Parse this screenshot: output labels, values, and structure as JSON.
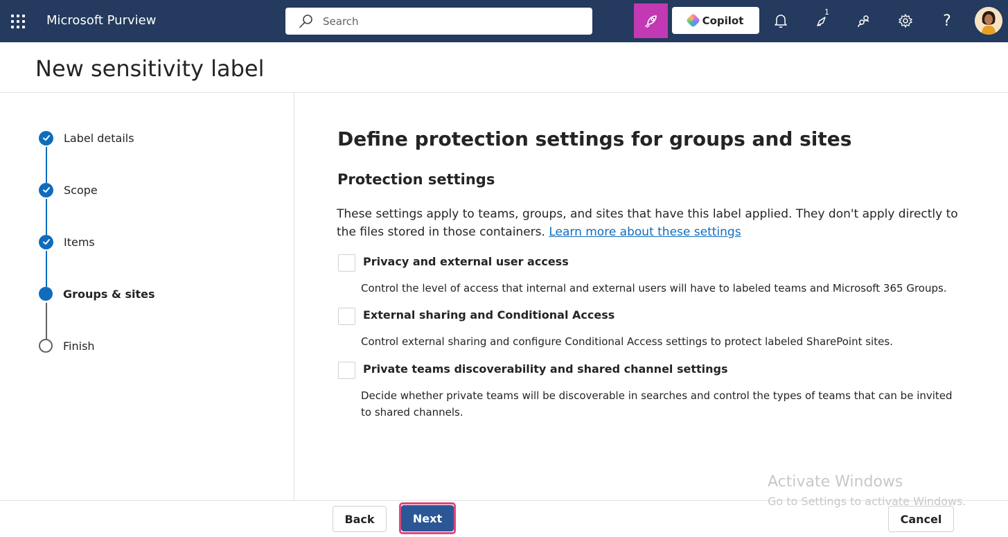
{
  "topbar": {
    "app_title": "Microsoft Purview",
    "search_placeholder": "Search",
    "copilot_label": "Copilot",
    "notification_badge": "1",
    "help_glyph": "?",
    "icons": [
      "waffle-icon",
      "search-icon",
      "rocket-icon",
      "copilot-icon",
      "bell-icon",
      "lightbulb-icon",
      "people-icon",
      "gear-icon",
      "help-icon",
      "avatar"
    ],
    "colors": {
      "bar": "#243a5e",
      "rocket": "#c239b3"
    }
  },
  "header": {
    "title": "New sensitivity label"
  },
  "steps": [
    {
      "label": "Label details",
      "state": "done"
    },
    {
      "label": "Scope",
      "state": "done"
    },
    {
      "label": "Items",
      "state": "done"
    },
    {
      "label": "Groups & sites",
      "state": "current"
    },
    {
      "label": "Finish",
      "state": "todo"
    }
  ],
  "main": {
    "heading": "Define protection settings for groups and sites",
    "section_heading": "Protection settings",
    "intro_text": "These settings apply to teams, groups, and sites that have this label applied. They don't apply directly to the files stored in those containers.",
    "learn_more_link": "Learn more about these settings",
    "options": [
      {
        "title": "Privacy and external user access",
        "description": "Control the level of access that internal and external users will have to labeled teams and Microsoft 365 Groups.",
        "checked": false
      },
      {
        "title": "External sharing and Conditional Access",
        "description": "Control external sharing and configure Conditional Access settings to protect labeled SharePoint sites.",
        "checked": false
      },
      {
        "title": "Private teams discoverability and shared channel settings",
        "description": "Decide whether private teams will be discoverable in searches and control the types of teams that can be invited to shared channels.",
        "checked": false
      }
    ]
  },
  "footer": {
    "back_label": "Back",
    "next_label": "Next",
    "cancel_label": "Cancel"
  },
  "watermark": {
    "title": "Activate Windows",
    "subtitle": "Go to Settings to activate Windows."
  },
  "colors": {
    "accent": "#0f6cbd",
    "next_button": "#2b5797",
    "highlight_border": "#e0457b"
  }
}
